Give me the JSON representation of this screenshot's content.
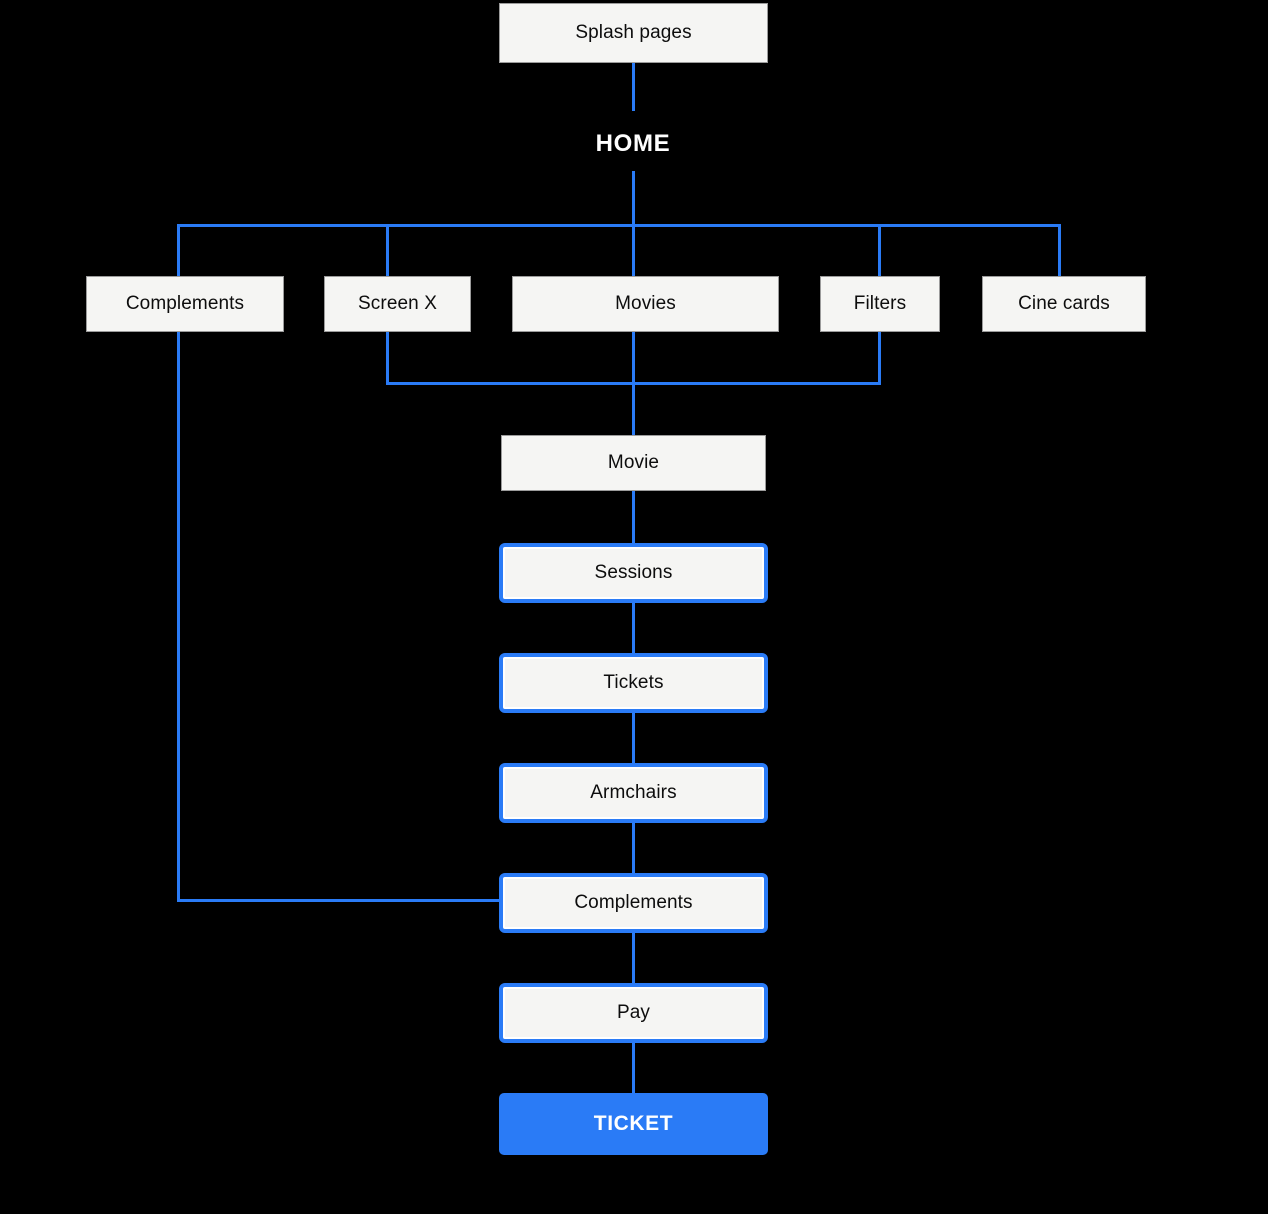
{
  "diagram": {
    "title": "Cinema app sitemap flowchart",
    "colors": {
      "background": "#000000",
      "line": "#2a7bf6",
      "node_fill": "#f5f5f3",
      "node_border": "#9b9b9b",
      "highlight_border": "#2a7bf6",
      "filled_node_bg": "#2a7bf6",
      "filled_node_text": "#ffffff",
      "node_text": "#0d0d0d",
      "label_text": "#ffffff"
    },
    "nodes": {
      "splash_pages": {
        "label": "Splash pages",
        "style": "plain"
      },
      "home": {
        "label": "HOME",
        "style": "text"
      },
      "complements_top": {
        "label": "Complements",
        "style": "plain"
      },
      "screen_x": {
        "label": "Screen X",
        "style": "plain"
      },
      "movies": {
        "label": "Movies",
        "style": "plain"
      },
      "filters": {
        "label": "Filters",
        "style": "plain"
      },
      "cine_cards": {
        "label": "Cine cards",
        "style": "plain"
      },
      "movie": {
        "label": "Movie",
        "style": "plain"
      },
      "sessions": {
        "label": "Sessions",
        "style": "highlighted"
      },
      "tickets": {
        "label": "Tickets",
        "style": "highlighted"
      },
      "armchairs": {
        "label": "Armchairs",
        "style": "highlighted"
      },
      "complements_flow": {
        "label": "Complements",
        "style": "highlighted"
      },
      "pay": {
        "label": "Pay",
        "style": "highlighted"
      },
      "ticket": {
        "label": "TICKET",
        "style": "filled"
      }
    }
  }
}
